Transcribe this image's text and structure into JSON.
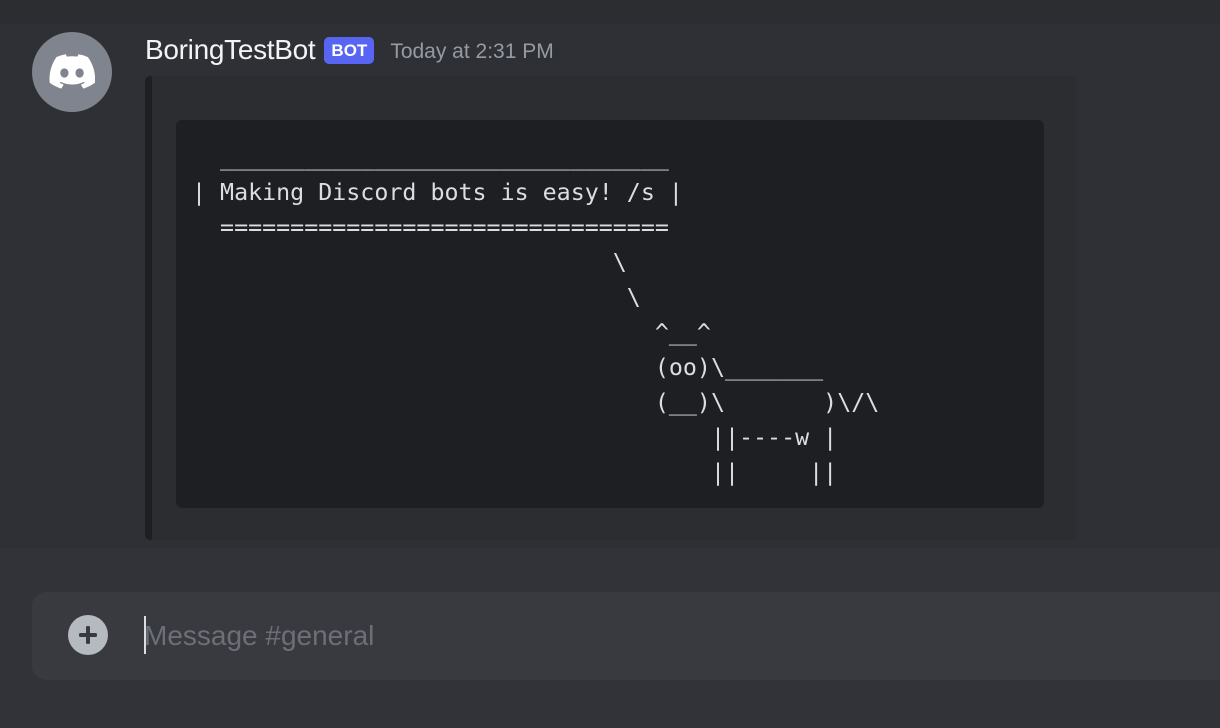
{
  "message": {
    "author": "BoringTestBot",
    "badge": "BOT",
    "timestamp": "Today at 2:31 PM",
    "avatar_icon": "discord-logo-icon",
    "code": "  ________________________________\n| Making Discord bots is easy! /s |\n  ================================\n                              \\\n                               \\\n                                 ^__^\n                                 (oo)\\_______\n                                 (__)\\       )\\/\\\n                                     ||----w |\n                                     ||     ||"
  },
  "composer": {
    "placeholder": "Message #general",
    "add_icon": "plus-circle-icon"
  },
  "colors": {
    "background": "#313338",
    "badge": "#5865f2",
    "codeblock": "#1e1f22"
  }
}
